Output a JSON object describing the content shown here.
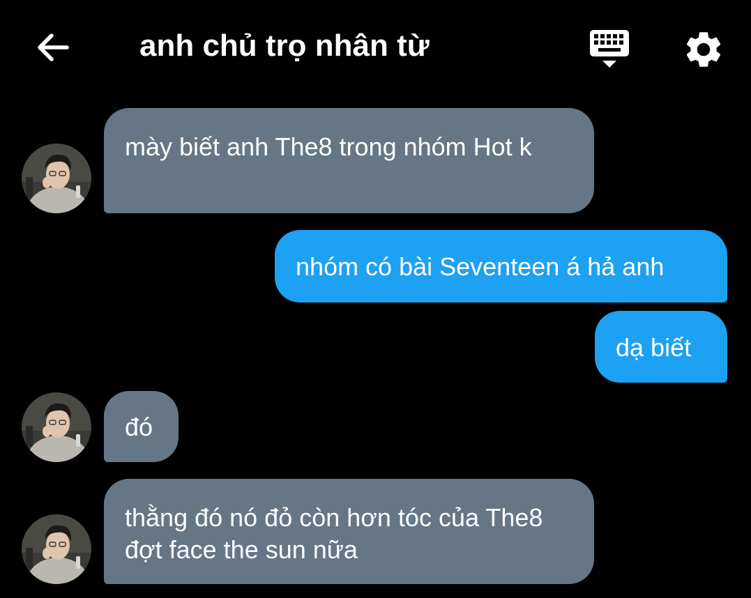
{
  "header": {
    "title": "anh chủ trọ nhân từ",
    "back_icon": "arrow-left-icon",
    "keyboard_icon": "keyboard-hide-icon",
    "settings_icon": "gear-icon"
  },
  "colors": {
    "background": "#000000",
    "incoming_bubble": "#657786",
    "outgoing_bubble": "#1da1f2",
    "text": "#ffffff"
  },
  "messages": [
    {
      "sender": "other",
      "text": "mày biết anh The8 trong nhóm Hot k"
    },
    {
      "sender": "me",
      "text": "nhóm có bài Seventeen á hả anh"
    },
    {
      "sender": "me",
      "text": "dạ biết"
    },
    {
      "sender": "other",
      "text": "đó"
    },
    {
      "sender": "other",
      "text": "thằng đó nó đỏ còn hơn tóc của The8 đợt face the sun nữa"
    }
  ]
}
